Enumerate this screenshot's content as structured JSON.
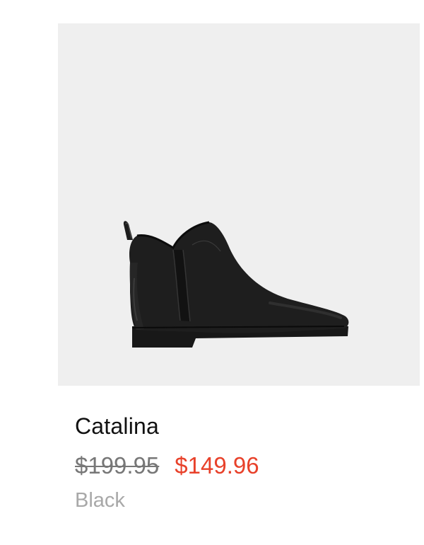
{
  "product": {
    "name": "Catalina",
    "price_original": "$199.95",
    "price_sale": "$149.96",
    "color": "Black",
    "image_icon": "ankle-boot-image"
  },
  "colors": {
    "image_background": "#efefef",
    "sale_price": "#e8412a",
    "original_price": "#777777",
    "color_label": "#a8a8a8",
    "boot": "#1b1b1b"
  }
}
